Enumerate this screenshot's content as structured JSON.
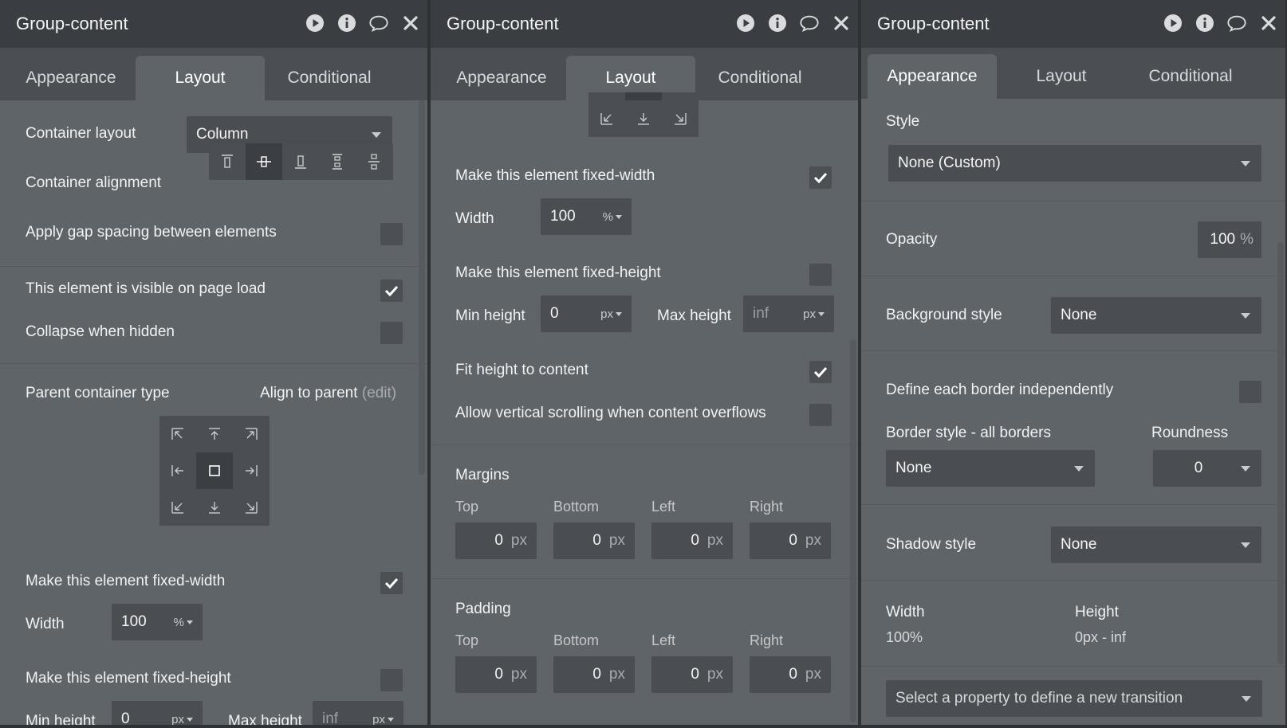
{
  "panels": [
    {
      "title": "Group-content",
      "tabs": [
        "Appearance",
        "Layout",
        "Conditional"
      ],
      "active_tab": "Layout",
      "container_layout_label": "Container layout",
      "container_layout_value": "Column",
      "container_alignment_label": "Container alignment",
      "gap_spacing_label": "Apply gap spacing between elements",
      "visible_on_load_label": "This element is visible on page load",
      "collapse_hidden_label": "Collapse when hidden",
      "parent_container_label": "Parent container type",
      "align_to_parent": "Align to parent",
      "edit_label": "(edit)",
      "fixed_width_label": "Make this element fixed-width",
      "width_label": "Width",
      "width_value": "100",
      "width_unit": "%",
      "fixed_height_label": "Make this element fixed-height",
      "min_height_label": "Min height",
      "min_height_value": "0",
      "min_height_unit": "px",
      "max_height_label": "Max height",
      "max_height_placeholder": "inf",
      "max_height_unit": "px"
    },
    {
      "title": "Group-content",
      "tabs": [
        "Appearance",
        "Layout",
        "Conditional"
      ],
      "active_tab": "Layout",
      "fixed_width_label": "Make this element fixed-width",
      "width_label": "Width",
      "width_value": "100",
      "width_unit": "%",
      "fixed_height_label": "Make this element fixed-height",
      "min_height_label": "Min height",
      "min_height_value": "0",
      "min_height_unit": "px",
      "max_height_label": "Max height",
      "max_height_placeholder": "inf",
      "max_height_unit": "px",
      "fit_height_label": "Fit height to content",
      "vertical_scroll_label": "Allow vertical scrolling when content overflows",
      "margins_label": "Margins",
      "padding_label": "Padding",
      "sides": [
        "Top",
        "Bottom",
        "Left",
        "Right"
      ],
      "margin_values": [
        "0",
        "0",
        "0",
        "0"
      ],
      "padding_values": [
        "0",
        "0",
        "0",
        "0"
      ],
      "px_unit": "px"
    },
    {
      "title": "Group-content",
      "tabs": [
        "Appearance",
        "Layout",
        "Conditional"
      ],
      "active_tab": "Appearance",
      "style_label": "Style",
      "style_value": "None (Custom)",
      "opacity_label": "Opacity",
      "opacity_value": "100",
      "opacity_unit": "%",
      "background_style_label": "Background style",
      "background_style_value": "None",
      "border_independent_label": "Define each border independently",
      "border_style_label": "Border style - all borders",
      "border_style_value": "None",
      "roundness_label": "Roundness",
      "roundness_value": "0",
      "shadow_style_label": "Shadow style",
      "shadow_style_value": "None",
      "width_label": "Width",
      "width_value": "100%",
      "height_label": "Height",
      "height_value": "0px - inf",
      "transition_placeholder": "Select a property to define a new transition"
    }
  ],
  "checkbox_states": {
    "p1_gap": false,
    "p1_visible": true,
    "p1_collapse": false,
    "p1_fixed_width": true,
    "p1_fixed_height": false,
    "p2_fixed_width": true,
    "p2_fixed_height": false,
    "p2_fit_height": true,
    "p2_vscroll": false,
    "p3_border_independent": false
  },
  "colors": {
    "panel_bg": "#5f6469",
    "titlebar_bg": "#3a3e43",
    "tabbar_bg": "#4b4f54",
    "field_bg": "#4a4e53"
  }
}
